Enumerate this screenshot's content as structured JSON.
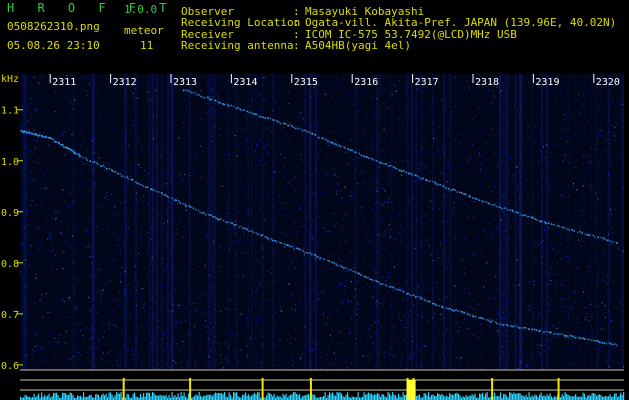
{
  "header": {
    "brand": "H R O F F T",
    "version": "1.0.0",
    "file_name": "0508262310.png",
    "datetime": "05.08.26 23:10",
    "meteor_label": "meteor",
    "meteor_count": "11",
    "fields": [
      {
        "label": "Observer",
        "value": "Masayuki Kobayashi"
      },
      {
        "label": "Receiving Location",
        "value": "Ogata-vill. Akita-Pref. JAPAN (139.96E, 40.02N)"
      },
      {
        "label": "Receiver",
        "value": "ICOM IC-575 53.7492(@LCD)MHz USB"
      },
      {
        "label": "Receiving antenna",
        "value": "A504HB(yagi 4el)"
      }
    ]
  },
  "chart_data": {
    "type": "heatmap",
    "ylabel": "kHz",
    "y_ticks": [
      "1.1",
      "1.0",
      "0.9",
      "0.8",
      "0.7",
      "0.6"
    ],
    "y_tick_values": [
      1.1,
      1.0,
      0.9,
      0.8,
      0.7,
      0.6
    ],
    "ylim": [
      0.59,
      1.17
    ],
    "time_ticks": [
      "2311",
      "2312",
      "2313",
      "2314",
      "2315",
      "2316",
      "2317",
      "2318",
      "2319",
      "2320"
    ],
    "xlim": [
      2310.5,
      2320.5
    ],
    "background_color": "#01061a",
    "noise_color": "#1f3cff",
    "trace_color": "#3aa6ff",
    "baseline_color": "#2bd4ff",
    "tick_color": "#dddd00",
    "traces": [
      {
        "points": [
          [
            2310.5,
            1.06
          ],
          [
            2311.0,
            1.045
          ],
          [
            2311.5,
            1.01
          ],
          [
            2312.5,
            0.955
          ],
          [
            2313.5,
            0.9
          ],
          [
            2314.5,
            0.855
          ],
          [
            2315.5,
            0.81
          ],
          [
            2316.5,
            0.76
          ],
          [
            2317.5,
            0.715
          ],
          [
            2318.5,
            0.68
          ],
          [
            2319.5,
            0.66
          ],
          [
            2320.4,
            0.64
          ]
        ]
      },
      {
        "points": [
          [
            2313.2,
            1.14
          ],
          [
            2314.2,
            1.1
          ],
          [
            2315.2,
            1.06
          ],
          [
            2316.2,
            1.01
          ],
          [
            2317.2,
            0.965
          ],
          [
            2318.2,
            0.92
          ],
          [
            2319.2,
            0.88
          ],
          [
            2320.4,
            0.84
          ]
        ]
      }
    ],
    "meteor_spikes": [
      2312.2,
      2313.3,
      2314.5,
      2315.3,
      2316.9,
      2317.0,
      2318.3,
      2319.4
    ]
  }
}
